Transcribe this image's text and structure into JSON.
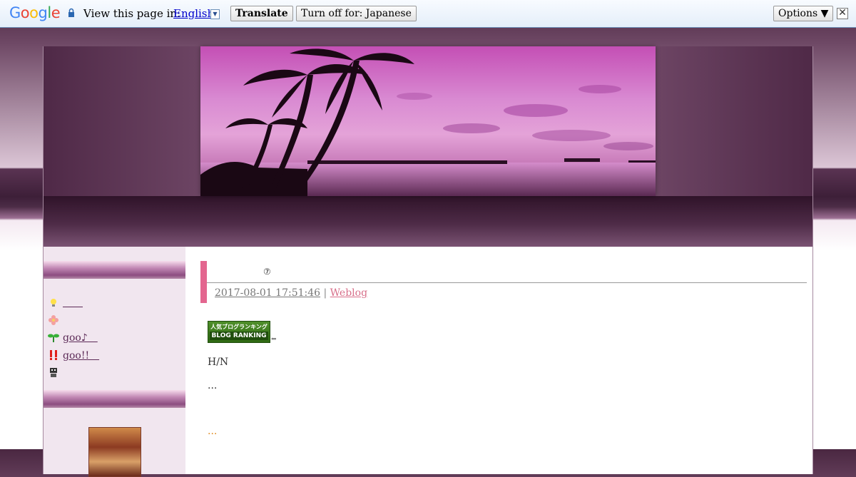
{
  "translate_bar": {
    "logo": "Google",
    "prompt": "View this page in:",
    "language": "English",
    "translate_label": "Translate",
    "turn_off_label": "Turn off for: Japanese",
    "options_label": "Options ▼",
    "close_glyph": "✕"
  },
  "sidebar": {
    "items": [
      {
        "icon": "light-bulb-icon",
        "label": "　　"
      },
      {
        "icon": "flower-icon",
        "label": ""
      },
      {
        "icon": "sprout-icon",
        "label": "goo♪　"
      },
      {
        "icon": "exclamation-icon",
        "label": "goo!!　"
      },
      {
        "icon": "robot-icon",
        "label": ""
      }
    ]
  },
  "post": {
    "title": "⑦",
    "date": "2017-08-01 17:51:46",
    "separator": "|",
    "category": "Weblog",
    "ranking_banner": {
      "line1": "人気ブログランキング",
      "line2": "BLOG RANKING"
    },
    "ranking_arrow": "⇐",
    "paragraph_1": "H/N",
    "paragraph_2": "...",
    "paragraph_3": "..."
  },
  "colors": {
    "accent_pink": "#e3668f",
    "link_purple": "#5c2a57",
    "category_pink": "#d86f8a",
    "orange_text": "#e08a1e"
  }
}
